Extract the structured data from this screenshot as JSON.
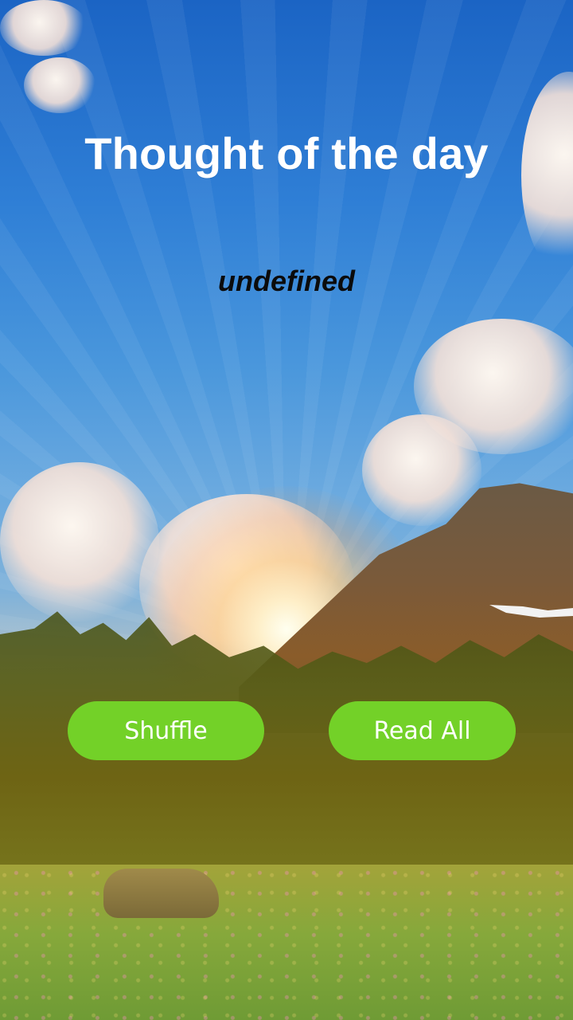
{
  "header": {
    "title": "Thought of the day"
  },
  "quote": {
    "text": "undefined"
  },
  "actions": {
    "shuffle_label": "Shuffle",
    "read_all_label": "Read All"
  },
  "theme": {
    "button_color": "#73d128",
    "title_color": "#ffffff",
    "quote_color": "#0b0b0b"
  }
}
